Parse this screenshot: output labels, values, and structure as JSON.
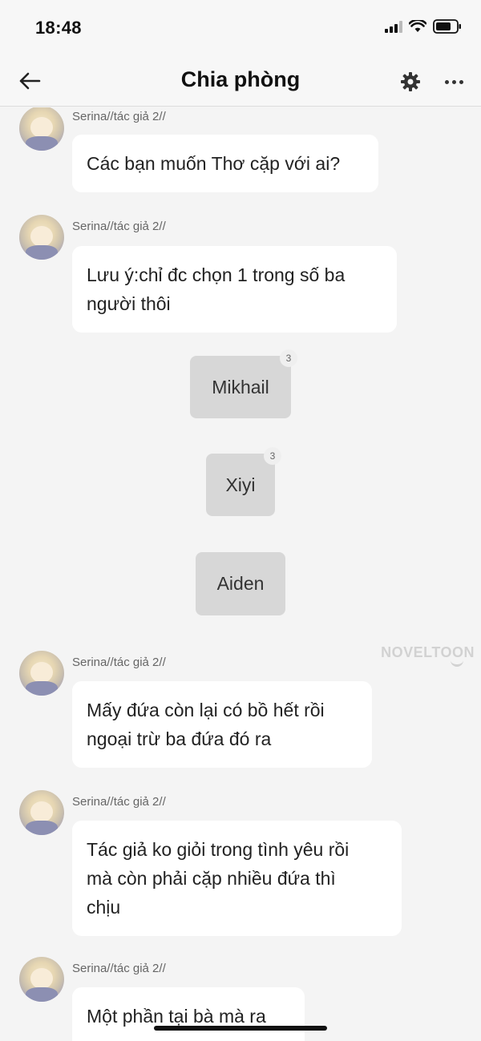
{
  "status_bar": {
    "time": "18:48"
  },
  "nav": {
    "title": "Chia phòng",
    "back_icon": "arrow-left-icon",
    "settings_icon": "gear-icon",
    "more_icon": "more-horizontal-icon"
  },
  "messages": [
    {
      "sender": "Serina//tác giả 2//",
      "text": "Các bạn muốn Thơ cặp với ai?"
    },
    {
      "sender": "Serina//tác giả 2//",
      "text_lines": [
        "Lưu ý:chỉ đc chọn 1 trong số ba",
        "người thôi"
      ]
    },
    {
      "sender": "Serina//tác giả 2//",
      "text_lines": [
        "Mấy đứa còn lại có bồ hết rồi",
        "ngoại trừ ba đứa đó ra"
      ]
    },
    {
      "sender": "Serina//tác giả 2//",
      "text_lines": [
        "Tác giả ko giỏi trong tình yêu rồi",
        "mà còn phải cặp nhiều đứa thì",
        "chịu"
      ]
    },
    {
      "sender": "Serina//tác giả 2//",
      "text": "Một phần tại bà mà ra"
    }
  ],
  "choices": [
    {
      "label": "Mikhail",
      "count": "3"
    },
    {
      "label": "Xiyi",
      "count": "3"
    },
    {
      "label": "Aiden"
    }
  ],
  "watermark": "NOVELTOON",
  "colors": {
    "background": "#f4f4f4",
    "bubble": "#ffffff",
    "choice": "#d7d7d7"
  }
}
